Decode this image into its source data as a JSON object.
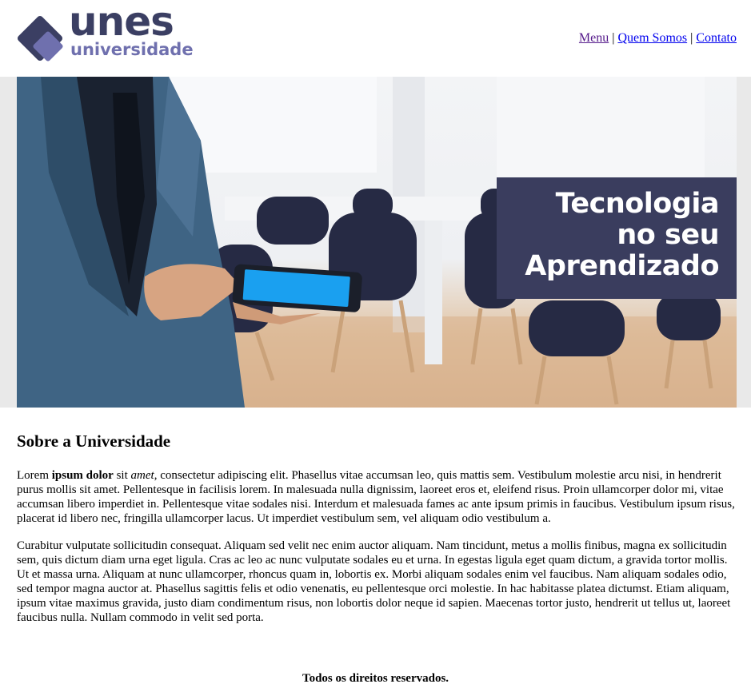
{
  "header": {
    "logo_word_main": "unes",
    "logo_word_sub": "universidade",
    "nav": {
      "menu": "Menu",
      "sep1": "|",
      "quem_somos": "Quem Somos",
      "sep2": "|",
      "contato": "Contato"
    }
  },
  "hero": {
    "banner_line1": "Tecnologia",
    "banner_line2": "no seu",
    "banner_line3": "Aprendizado"
  },
  "main": {
    "title": "Sobre a Universidade",
    "p1_lorem": "Lorem ",
    "p1_bold": "ipsum dolor",
    "p1_sit": " sit ",
    "p1_italic": "amet",
    "p1_rest": ", consectetur adipiscing elit. Phasellus vitae accumsan leo, quis mattis sem. Vestibulum molestie arcu nisi, in hendrerit purus mollis sit amet. Pellentesque in facilisis lorem. In malesuada nulla dignissim, laoreet eros et, eleifend risus. Proin ullamcorper dolor mi, vitae accumsan libero imperdiet in. Pellentesque vitae sodales nisi. Interdum et malesuada fames ac ante ipsum primis in faucibus. Vestibulum ipsum risus, placerat id libero nec, fringilla ullamcorper lacus. Ut imperdiet vestibulum sem, vel aliquam odio vestibulum a.",
    "p2": "Curabitur vulputate sollicitudin consequat. Aliquam sed velit nec enim auctor aliquam. Nam tincidunt, metus a mollis finibus, magna ex sollicitudin sem, quis dictum diam urna eget ligula. Cras ac leo ac nunc vulputate sodales eu et urna. In egestas ligula eget quam dictum, a gravida tortor mollis. Ut et massa urna. Aliquam at nunc ullamcorper, rhoncus quam in, lobortis ex. Morbi aliquam sodales enim vel faucibus. Nam aliquam sodales odio, sed tempor magna auctor at. Phasellus sagittis felis et odio venenatis, eu pellentesque orci molestie. In hac habitasse platea dictumst. Etiam aliquam, ipsum vitae maximus gravida, justo diam condimentum risus, non lobortis dolor neque id sapien. Maecenas tortor justo, hendrerit ut tellus ut, laoreet faucibus nulla. Nullam commodo in velit sed porta."
  },
  "footer": {
    "text": "Todos os direitos reservados."
  },
  "colors": {
    "brand_dark": "#3b3f63",
    "brand_light": "#6f70ae",
    "banner_bg": "#3a3d5e",
    "link": "#0000ee",
    "link_visited": "#551a8b"
  },
  "icons": {
    "logo": "unes-logo-diamond"
  }
}
